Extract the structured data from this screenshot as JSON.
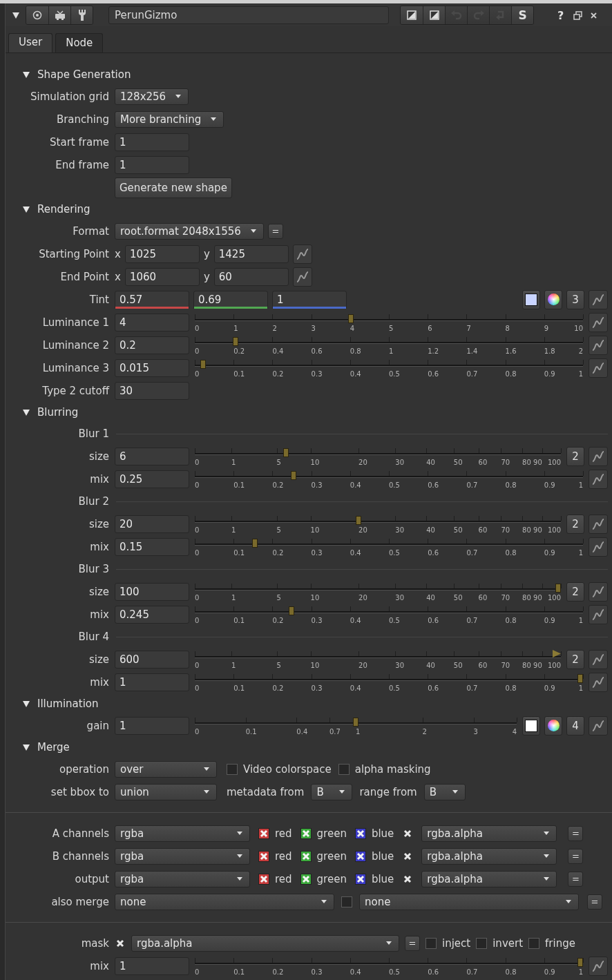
{
  "header": {
    "node_name": "PerunGizmo",
    "history": [
      {
        "disabled": true
      },
      {
        "disabled": true
      },
      {
        "disabled": true
      }
    ],
    "s_label": "S",
    "help_label": "?"
  },
  "tabs": [
    {
      "label": "User",
      "selected": true
    },
    {
      "label": "Node",
      "selected": false
    }
  ],
  "rows": [
    {
      "kind": "section",
      "label": "Shape Generation",
      "expanded": true
    },
    {
      "kind": "row",
      "label": "Simulation grid",
      "items": [
        {
          "kind": "dropdown",
          "value": "128x256"
        }
      ]
    },
    {
      "kind": "row",
      "label": "Branching",
      "items": [
        {
          "kind": "dropdown",
          "value": "More branching"
        }
      ]
    },
    {
      "kind": "row",
      "label": "Start frame",
      "items": [
        {
          "kind": "input",
          "value": "1"
        }
      ]
    },
    {
      "kind": "row",
      "label": "End frame",
      "items": [
        {
          "kind": "input",
          "value": "1"
        }
      ]
    },
    {
      "kind": "row",
      "items": [
        {
          "kind": "button",
          "label": "Generate new shape"
        }
      ]
    },
    {
      "kind": "section",
      "label": "Rendering",
      "expanded": true
    },
    {
      "kind": "row",
      "label": "Format",
      "items": [
        {
          "kind": "dropdown",
          "value": "root.format 2048x1556"
        },
        {
          "kind": "equals",
          "label": "="
        }
      ]
    },
    {
      "kind": "row",
      "label": "Starting Point",
      "items": [
        {
          "kind": "text",
          "text": "x"
        },
        {
          "kind": "input",
          "value": "1025"
        },
        {
          "kind": "text",
          "text": "y"
        },
        {
          "kind": "input",
          "value": "1425"
        },
        {
          "kind": "curve"
        }
      ]
    },
    {
      "kind": "row",
      "label": "End Point",
      "items": [
        {
          "kind": "text",
          "text": "x"
        },
        {
          "kind": "input",
          "value": "1060"
        },
        {
          "kind": "text",
          "text": "y"
        },
        {
          "kind": "input",
          "value": "60"
        },
        {
          "kind": "curve"
        }
      ]
    },
    {
      "kind": "row",
      "label": "Tint",
      "items": [
        {
          "kind": "input",
          "value": "0.57",
          "color": "#c84848"
        },
        {
          "kind": "input",
          "value": "0.69",
          "color": "#52a852"
        },
        {
          "kind": "input",
          "value": "1",
          "color": "#4a6ac8"
        },
        {
          "kind": "swatch",
          "color": "#c9d4ff"
        },
        {
          "kind": "wheel"
        },
        {
          "kind": "count",
          "label": "3"
        },
        {
          "kind": "curve"
        }
      ]
    },
    {
      "kind": "row",
      "label": "Luminance 1",
      "items": [
        {
          "kind": "input",
          "value": "4"
        },
        {
          "kind": "slider",
          "level": 0.4,
          "ticks": [
            "0",
            "1",
            "2",
            "3",
            "4",
            "5",
            "6",
            "7",
            "8",
            "9",
            "10"
          ]
        },
        {
          "kind": "curve"
        }
      ]
    },
    {
      "kind": "row",
      "label": "Luminance 2",
      "items": [
        {
          "kind": "input",
          "value": "0.2"
        },
        {
          "kind": "slider",
          "level": 0.1,
          "ticks": [
            "0",
            "0.2",
            "0.4",
            "0.6",
            "0.8",
            "1",
            "1.2",
            "1.4",
            "1.6",
            "1.8",
            "2"
          ]
        },
        {
          "kind": "curve"
        }
      ]
    },
    {
      "kind": "row",
      "label": "Luminance 3",
      "items": [
        {
          "kind": "input",
          "value": "0.015"
        },
        {
          "kind": "slider",
          "level": 0.015,
          "ticks": [
            "0",
            "0.1",
            "0.2",
            "0.3",
            "0.4",
            "0.5",
            "0.6",
            "0.7",
            "0.8",
            "0.9",
            "1"
          ]
        },
        {
          "kind": "curve"
        }
      ]
    },
    {
      "kind": "row",
      "label": "Type 2 cutoff",
      "items": [
        {
          "kind": "input",
          "value": "30"
        }
      ]
    },
    {
      "kind": "section",
      "label": "Blurring",
      "expanded": true
    },
    {
      "kind": "subheading",
      "label": "Blur 1"
    },
    {
      "kind": "row",
      "label": "size",
      "items": [
        {
          "kind": "input",
          "value": "6"
        },
        {
          "kind": "root-slider",
          "level": 0.245,
          "ticks": [
            "0",
            "1",
            "5",
            "10",
            "20",
            "30",
            "40",
            "50",
            "60",
            "70",
            "80",
            "90",
            "100"
          ]
        },
        {
          "kind": "count",
          "label": "2"
        },
        {
          "kind": "curve"
        }
      ]
    },
    {
      "kind": "row",
      "label": "mix",
      "items": [
        {
          "kind": "input",
          "value": "0.25"
        },
        {
          "kind": "slider",
          "level": 0.25,
          "ticks": [
            "0",
            "0.1",
            "0.2",
            "0.3",
            "0.4",
            "0.5",
            "0.6",
            "0.7",
            "0.8",
            "0.9",
            "1"
          ]
        },
        {
          "kind": "curve"
        }
      ]
    },
    {
      "kind": "subheading",
      "label": "Blur 2"
    },
    {
      "kind": "row",
      "label": "size",
      "items": [
        {
          "kind": "input",
          "value": "20"
        },
        {
          "kind": "root-slider",
          "level": 0.447,
          "ticks": [
            "0",
            "1",
            "5",
            "10",
            "20",
            "30",
            "40",
            "50",
            "60",
            "70",
            "80",
            "90",
            "100"
          ]
        },
        {
          "kind": "count",
          "label": "2"
        },
        {
          "kind": "curve"
        }
      ]
    },
    {
      "kind": "row",
      "label": "mix",
      "items": [
        {
          "kind": "input",
          "value": "0.15"
        },
        {
          "kind": "slider",
          "level": 0.15,
          "ticks": [
            "0",
            "0.1",
            "0.2",
            "0.3",
            "0.4",
            "0.5",
            "0.6",
            "0.7",
            "0.8",
            "0.9",
            "1"
          ]
        },
        {
          "kind": "curve"
        }
      ]
    },
    {
      "kind": "subheading",
      "label": "Blur 3"
    },
    {
      "kind": "row",
      "label": "size",
      "items": [
        {
          "kind": "input",
          "value": "100"
        },
        {
          "kind": "root-slider",
          "level": 1,
          "ticks": [
            "0",
            "1",
            "5",
            "10",
            "20",
            "30",
            "40",
            "50",
            "60",
            "70",
            "80",
            "90",
            "100"
          ]
        },
        {
          "kind": "count",
          "label": "2"
        },
        {
          "kind": "curve"
        }
      ]
    },
    {
      "kind": "row",
      "label": "mix",
      "items": [
        {
          "kind": "input",
          "value": "0.245"
        },
        {
          "kind": "slider",
          "level": 0.245,
          "ticks": [
            "0",
            "0.1",
            "0.2",
            "0.3",
            "0.4",
            "0.5",
            "0.6",
            "0.7",
            "0.8",
            "0.9",
            "1"
          ]
        },
        {
          "kind": "curve"
        }
      ]
    },
    {
      "kind": "subheading",
      "label": "Blur 4"
    },
    {
      "kind": "row",
      "label": "size",
      "items": [
        {
          "kind": "input",
          "value": "600"
        },
        {
          "kind": "root-slider",
          "level": 1,
          "overflow": true,
          "ticks": [
            "0",
            "1",
            "5",
            "10",
            "20",
            "30",
            "40",
            "50",
            "60",
            "70",
            "80",
            "90",
            "100"
          ]
        },
        {
          "kind": "count",
          "label": "2"
        },
        {
          "kind": "curve"
        }
      ]
    },
    {
      "kind": "row",
      "label": "mix",
      "items": [
        {
          "kind": "input",
          "value": "1"
        },
        {
          "kind": "slider",
          "level": 1,
          "ticks": [
            "0",
            "0.1",
            "0.2",
            "0.3",
            "0.4",
            "0.5",
            "0.6",
            "0.7",
            "0.8",
            "0.9",
            "1"
          ]
        },
        {
          "kind": "curve"
        }
      ]
    },
    {
      "kind": "section",
      "label": "Illumination",
      "expanded": true
    },
    {
      "kind": "row",
      "label": "gain",
      "items": [
        {
          "kind": "input",
          "value": "1"
        },
        {
          "kind": "root-slider",
          "level": 0.5,
          "ticks": [
            "0",
            "0.1",
            "0.4",
            "0.7",
            "1",
            "2",
            "3",
            "4"
          ]
        },
        {
          "kind": "swatch",
          "color": "#ffffff"
        },
        {
          "kind": "wheel"
        },
        {
          "kind": "count",
          "label": "4"
        },
        {
          "kind": "curve"
        }
      ]
    },
    {
      "kind": "section",
      "label": "Merge",
      "expanded": true
    },
    {
      "kind": "merge",
      "label": "operation",
      "items": [
        {
          "kind": "dropdown",
          "value": "over"
        },
        {
          "kind": "checkbox",
          "checked": false,
          "label": "Video colorspace"
        },
        {
          "kind": "checkbox",
          "checked": false,
          "label": "alpha masking"
        }
      ]
    },
    {
      "kind": "merge",
      "label": "set bbox to",
      "items": [
        {
          "kind": "dropdown",
          "value": "union"
        },
        {
          "kind": "text",
          "text": "metadata from"
        },
        {
          "kind": "dropdown",
          "value": "B"
        },
        {
          "kind": "text",
          "text": "range from"
        },
        {
          "kind": "dropdown",
          "value": "B"
        }
      ]
    },
    {
      "kind": "divider"
    },
    {
      "kind": "channels",
      "label": "A channels",
      "items": [
        {
          "kind": "dropdown",
          "value": "rgba"
        },
        {
          "kind": "checkbox",
          "checked": true,
          "color": "#c83c3c",
          "label": "red"
        },
        {
          "kind": "checkbox",
          "checked": true,
          "color": "#3caa3c",
          "label": "green"
        },
        {
          "kind": "checkbox",
          "checked": true,
          "color": "#3c3cc8",
          "label": "blue"
        },
        {
          "kind": "checkbox",
          "checked": true
        },
        {
          "kind": "dropdown",
          "value": "rgba.alpha"
        },
        {
          "kind": "equals",
          "label": "="
        }
      ]
    },
    {
      "kind": "channels",
      "label": "B channels",
      "items": [
        {
          "kind": "dropdown",
          "value": "rgba"
        },
        {
          "kind": "checkbox",
          "checked": true,
          "color": "#c83c3c",
          "label": "red"
        },
        {
          "kind": "checkbox",
          "checked": true,
          "color": "#3caa3c",
          "label": "green"
        },
        {
          "kind": "checkbox",
          "checked": true,
          "color": "#3c3cc8",
          "label": "blue"
        },
        {
          "kind": "checkbox",
          "checked": true
        },
        {
          "kind": "dropdown",
          "value": "rgba.alpha"
        },
        {
          "kind": "equals",
          "label": "="
        }
      ]
    },
    {
      "kind": "channels",
      "label": "output",
      "items": [
        {
          "kind": "dropdown",
          "value": "rgba"
        },
        {
          "kind": "checkbox",
          "checked": true,
          "color": "#c83c3c",
          "label": "red"
        },
        {
          "kind": "checkbox",
          "checked": true,
          "color": "#3caa3c",
          "label": "green"
        },
        {
          "kind": "checkbox",
          "checked": true,
          "color": "#3c3cc8",
          "label": "blue"
        },
        {
          "kind": "checkbox",
          "checked": true
        },
        {
          "kind": "dropdown",
          "value": "rgba.alpha"
        },
        {
          "kind": "equals",
          "label": "="
        }
      ]
    },
    {
      "kind": "pair",
      "label": "also merge",
      "items": [
        {
          "kind": "dropdown",
          "value": "none"
        },
        {
          "kind": "checkbox",
          "checked": false
        },
        {
          "kind": "dropdown",
          "value": "none"
        },
        {
          "kind": "equals",
          "label": "="
        }
      ]
    },
    {
      "kind": "divider"
    },
    {
      "kind": "mask",
      "label": "mask",
      "items": [
        {
          "kind": "checkbox",
          "checked": true
        },
        {
          "kind": "dropdown",
          "value": "rgba.alpha"
        },
        {
          "kind": "equals",
          "label": "="
        },
        {
          "kind": "checkbox",
          "checked": false,
          "label": "inject"
        },
        {
          "kind": "checkbox",
          "checked": false,
          "label": "invert"
        },
        {
          "kind": "checkbox",
          "checked": false,
          "label": "fringe"
        }
      ]
    },
    {
      "kind": "row",
      "label": "mix",
      "items": [
        {
          "kind": "input",
          "value": "1"
        },
        {
          "kind": "slider",
          "level": 1,
          "ticks": [
            "0",
            "0.1",
            "0.2",
            "0.3",
            "0.4",
            "0.5",
            "0.6",
            "0.7",
            "0.8",
            "0.9",
            "1"
          ]
        },
        {
          "kind": "curve"
        }
      ]
    }
  ]
}
